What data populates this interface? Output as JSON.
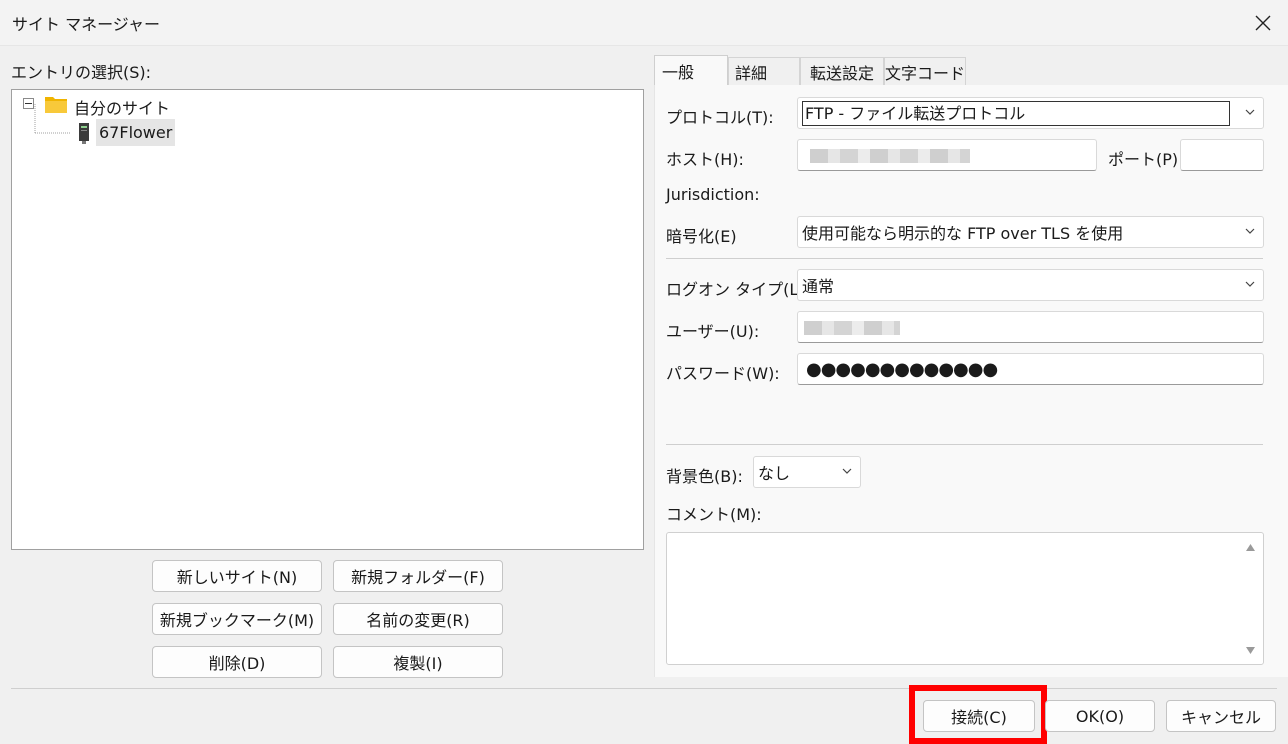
{
  "window": {
    "title": "サイト マネージャー"
  },
  "left": {
    "entry_label": "エントリの選択(S):",
    "tree": {
      "root": "自分のサイト",
      "children": [
        "67Flower"
      ]
    },
    "buttons": {
      "new_site": "新しいサイト(N)",
      "new_folder": "新規フォルダー(F)",
      "new_bookmark": "新規ブックマーク(M)",
      "rename": "名前の変更(R)",
      "delete": "削除(D)",
      "duplicate": "複製(I)"
    }
  },
  "tabs": [
    "一般",
    "詳細",
    "転送設定",
    "文字コード"
  ],
  "general": {
    "protocol_label": "プロトコル(T):",
    "protocol_value": "FTP - ファイル転送プロトコル",
    "host_label": "ホスト(H):",
    "port_label": "ポート(P):",
    "port_value": "",
    "jurisdiction_label": "Jurisdiction:",
    "encryption_label": "暗号化(E)",
    "encryption_value": "使用可能なら明示的な FTP over TLS を使用",
    "logon_label": "ログオン タイプ(L):",
    "logon_value": "通常",
    "user_label": "ユーザー(U):",
    "password_label": "パスワード(W):",
    "password_value": "●●●●●●●●●●●●●",
    "bgcolor_label": "背景色(B):",
    "bgcolor_value": "なし",
    "comment_label": "コメント(M):",
    "comment_value": ""
  },
  "footer": {
    "connect": "接続(C)",
    "ok": "OK(O)",
    "cancel": "キャンセル"
  },
  "colors": {
    "highlight": "#ff0000",
    "folder": "#f0b400"
  }
}
